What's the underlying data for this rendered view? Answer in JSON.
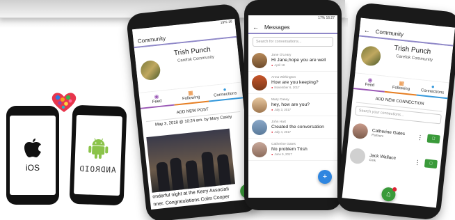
{
  "badges": {
    "ios_label": "iOS",
    "android_label": "ANDROID"
  },
  "status_bar": {
    "left_phone": "19% 16",
    "middle_phone": "17% 16:27"
  },
  "community_screen": {
    "title": "Community",
    "profile_name": "Trish Punch",
    "community_name": "Carefok Community",
    "tabs": [
      "Feed",
      "Following",
      "Connections"
    ],
    "add_post_label": "ADD NEW POST",
    "post_meta": "May 3, 2018 @ 10:24 am.  by  Mary Casey",
    "post_text_line1": "onderful night at the Kerry Associati",
    "post_text_line2": "nner. Congratulations Colm Cooper"
  },
  "messages_screen": {
    "title": "Messages",
    "search_placeholder": "Search for conversations...",
    "conversations": [
      {
        "name": "Jane O'Leary",
        "text": "Hi Jane,hope you are well",
        "date": "April 18"
      },
      {
        "name": "Anna Withington",
        "text": "How are you keeping?",
        "date": "November 6, 2017"
      },
      {
        "name": "Mary Casey",
        "text": "hey, how are you?",
        "date": "July 3, 2017"
      },
      {
        "name": "John Hart",
        "text": "Created the conversation",
        "date": "July 4, 2017"
      },
      {
        "name": "Catherine Gates",
        "text": "No problem Trish",
        "date": "June 9, 2017"
      }
    ],
    "fab_label": "+"
  },
  "connections_screen": {
    "title": "Community",
    "profile_name": "Trish Punch",
    "community_name": "Carefok Community",
    "tabs": [
      "Feed",
      "Following",
      "Connections"
    ],
    "add_connection_label": "ADD NEW CONNECTION",
    "search_placeholder": "Search your connections...",
    "connections": [
      {
        "name": "Catherine Gates",
        "sub": "Partners"
      },
      {
        "name": "Jack Wallace",
        "sub": "Cork"
      }
    ]
  },
  "colors": {
    "accent_purple": "#8f88c8",
    "feed": "#9b59b6",
    "following": "#e67e22",
    "connections": "#3498db",
    "fab_green": "#3a9a3a",
    "fab_blue": "#2f86e0"
  }
}
